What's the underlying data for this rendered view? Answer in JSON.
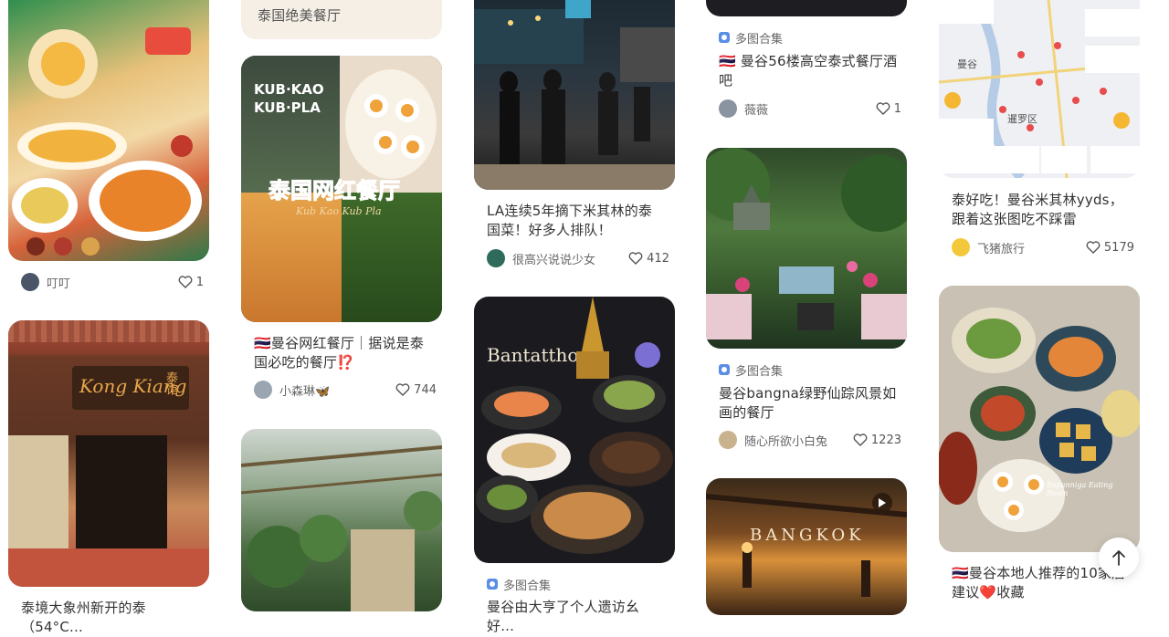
{
  "cards": {
    "c1": {
      "author": "叮叮",
      "likes": "1"
    },
    "c2": {
      "title": "泰境大象州新开的泰（54°C..."
    },
    "c3": {
      "title": "泰国绝美餐厅"
    },
    "c4": {
      "title": "🇹🇭曼谷网红餐厅｜据说是泰国必吃的餐厅⁉️",
      "author": "小森琳🦋",
      "likes": "744"
    },
    "c5": {
      "title": ""
    },
    "c6": {
      "title": "LA连续5年摘下米其林的泰国菜！好多人排队！",
      "author": "很高兴说说少女",
      "likes": "412"
    },
    "c7": {
      "tag": "多图合集",
      "title": "曼谷由大亨了个人遗访幺好..."
    },
    "c8": {
      "tag": "多图合集",
      "title": "🇹🇭 曼谷56楼高空泰式餐厅酒吧",
      "author": "薇薇",
      "likes": "1"
    },
    "c9": {
      "tag": "多图合集",
      "title": "曼谷bangna绿野仙踪风景如画的餐厅",
      "author": "随心所欲小白兔",
      "likes": "1223"
    },
    "c10": {
      "title": "泰好吃！曼谷米其林yyds，跟着这张图吃不踩雷",
      "author": "飞猪旅行",
      "likes": "5179"
    },
    "c11": {
      "title": "🇹🇭曼谷本地人推荐的10家店建议❤️收藏"
    }
  },
  "image_text": {
    "kubkao_line1": "KUB·KAO",
    "kubkao_line2": "KUB·PLA",
    "kubkao_banner": "泰国网红餐厅",
    "kubkao_sub": "Kub Kao Kub Pla",
    "kongkiang": "Kong Kiang",
    "kongkiang_cn": "泰馆",
    "bantatthong": "Bantatthong",
    "bangkok": "BANGKOK",
    "map_district1": "曼谷",
    "map_district2": "暹罗区",
    "supanniga": "Supanniga Eating Room"
  },
  "colors": {
    "accent": "#ff2442",
    "tag_icon": "#5a8ee6"
  },
  "back_to_top": {
    "icon": "arrow-up-icon"
  }
}
